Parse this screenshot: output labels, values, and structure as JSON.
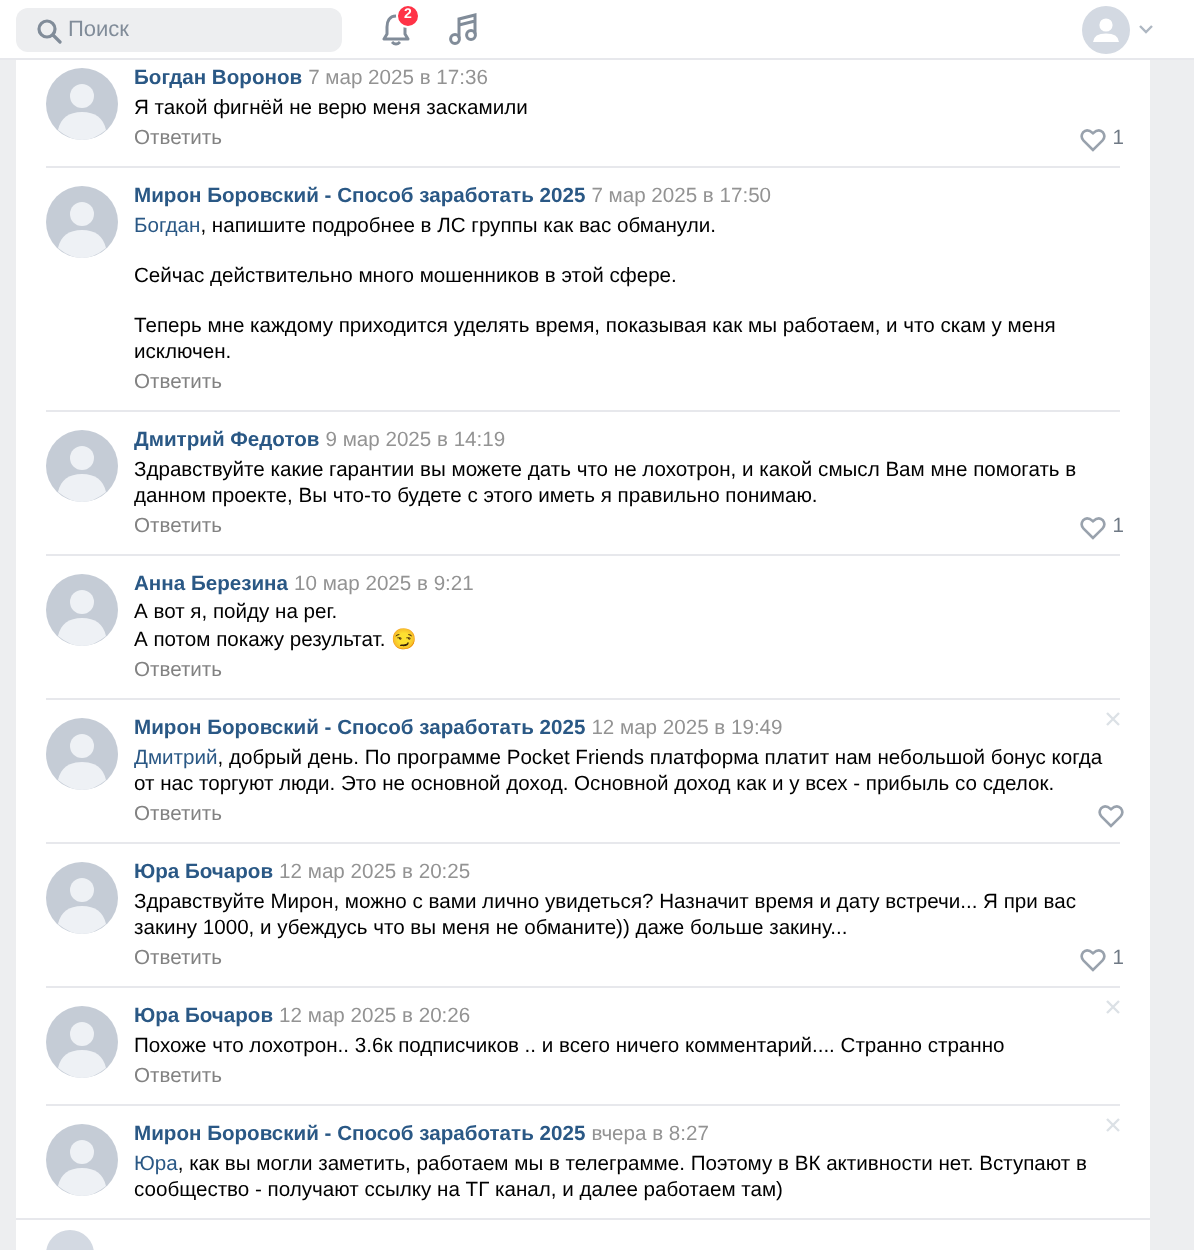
{
  "header": {
    "search": {
      "placeholder": "Поиск"
    },
    "notifications": {
      "badge": "2"
    }
  },
  "comments": [
    {
      "author": "Богдан Воронов",
      "date": "7 мар 2025 в 17:36",
      "paragraphs": [
        "Я такой фигнёй не верю меня заскамили"
      ],
      "reply": "Ответить",
      "like": true,
      "likes": "1",
      "closable": false
    },
    {
      "author": "Мирон Боровский - Способ заработать 2025",
      "date": "7 мар 2025 в 17:50",
      "mention": "Богдан",
      "paragraphs": [
        ", напишите подробнее в ЛС группы как вас обманули.",
        "Сейчас действительно много мошенников в этой сфере.",
        "Теперь мне каждому приходится уделять время, показывая как мы работаем, и что скам у меня исключен."
      ],
      "reply": "Ответить",
      "closable": false
    },
    {
      "author": "Дмитрий Федотов",
      "date": "9 мар 2025 в 14:19",
      "paragraphs": [
        "Здравствуйте какие гарантии вы можете дать что не лохотрон, и какой смысл Вам мне помогать в данном проекте, Вы что-то будете с этого иметь я правильно понимаю."
      ],
      "reply": "Ответить",
      "like": true,
      "likes": "1",
      "closable": false
    },
    {
      "author": "Анна Березина",
      "date": "10 мар 2025 в 9:21",
      "lines": [
        "А вот я, пойду на рег.",
        "А потом покажу результат. 😏"
      ],
      "reply": "Ответить",
      "closable": false
    },
    {
      "author": "Мирон Боровский - Способ заработать 2025",
      "date": "12 мар 2025 в 19:49",
      "mention": "Дмитрий",
      "paragraphs": [
        ", добрый день. По программе Pocket Friends платформа платит нам небольшой бонус когда от нас торгуют люди. Это не основной доход. Основной доход как и у всех - прибыль со сделок."
      ],
      "reply": "Ответить",
      "like": true,
      "closable": true
    },
    {
      "author": "Юра Бочаров",
      "date": "12 мар 2025 в 20:25",
      "paragraphs": [
        "Здравствуйте Мирон, можно с вами лично увидеться? Назначит время и дату встречи... Я при вас закину 1000, и убеждусь что вы меня не обманите)) даже больше закину..."
      ],
      "reply": "Ответить",
      "like": true,
      "likes": "1",
      "closable": false
    },
    {
      "author": "Юра Бочаров",
      "date": "12 мар 2025 в 20:26",
      "paragraphs": [
        "Похоже что лохотрон.. 3.6к подписчиков .. и всего ничего комментарий.... Странно странно"
      ],
      "reply": "Ответить",
      "closable": true
    },
    {
      "author": "Мирон Боровский - Способ заработать 2025",
      "date": "вчера в 8:27",
      "mention": "Юра",
      "paragraphs": [
        ", как вы могли заметить, работаем мы в телеграмме. Поэтому в ВК активности нет. Вступают в сообщество - получают ссылку на ТГ канал, и далее работаем там)"
      ],
      "closable": true
    }
  ]
}
